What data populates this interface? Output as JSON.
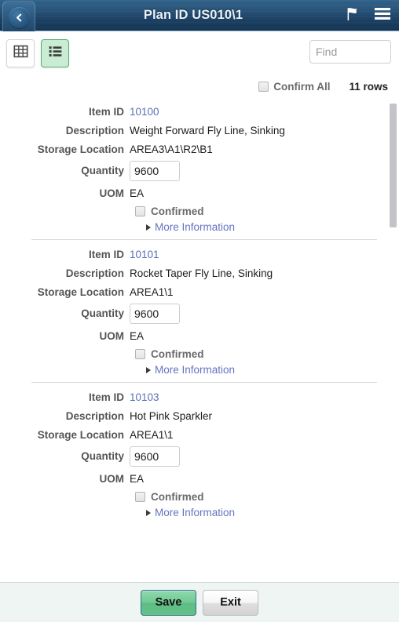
{
  "header": {
    "title": "Plan ID US010\\1",
    "back_icon": "back-chevron-icon",
    "flag_icon": "flag-icon",
    "menu_icon": "hamburger-menu-icon"
  },
  "toolbar": {
    "grid_view_icon": "grid-view-icon",
    "list_view_icon": "list-view-icon",
    "active_view": "list",
    "search": {
      "placeholder": "Find",
      "value": ""
    }
  },
  "confirm_all": {
    "label": "Confirm All",
    "checked": false,
    "rows_count": "11 rows"
  },
  "field_labels": {
    "item_id": "Item ID",
    "description": "Description",
    "storage_location": "Storage Location",
    "quantity": "Quantity",
    "uom": "UOM",
    "confirmed": "Confirmed",
    "more_information": "More Information"
  },
  "items": [
    {
      "item_id": "10100",
      "description": "Weight Forward Fly Line, Sinking",
      "storage_location": "AREA3\\A1\\R2\\B1",
      "quantity": "9600",
      "uom": "EA",
      "confirmed": false
    },
    {
      "item_id": "10101",
      "description": "Rocket Taper Fly Line, Sinking",
      "storage_location": "AREA1\\1",
      "quantity": "9600",
      "uom": "EA",
      "confirmed": false
    },
    {
      "item_id": "10103",
      "description": "Hot Pink Sparkler",
      "storage_location": "AREA1\\1",
      "quantity": "9600",
      "uom": "EA",
      "confirmed": false
    }
  ],
  "footer": {
    "save_label": "Save",
    "exit_label": "Exit"
  },
  "colors": {
    "header_top": "#31628a",
    "header_bottom": "#153451",
    "accent_green": "#5fbc85",
    "active_view_bg": "#c9ecd2",
    "link": "#6574c0",
    "label": "#555555",
    "footer_bg": "#eef5f3"
  }
}
